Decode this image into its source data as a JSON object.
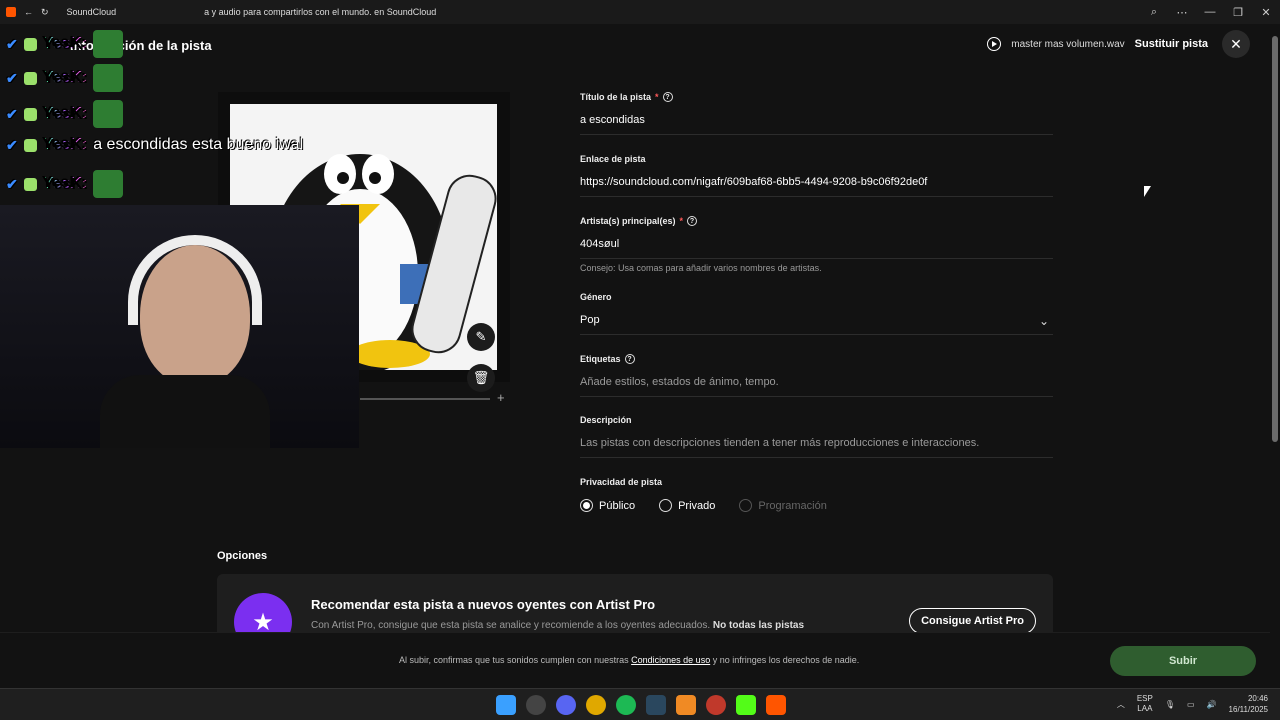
{
  "window": {
    "title": "SoundCloud",
    "title_suffix": "a y audio para compartirlos con el mundo. en SoundCloud"
  },
  "header": {
    "title": "Información de la pista",
    "file_name": "master mas volumen.wav",
    "replace_label": "Sustituir pista",
    "close_icon": "close-icon"
  },
  "form": {
    "title": {
      "label": "Título de la pista",
      "value": "a escondidas"
    },
    "link": {
      "label": "Enlace de pista",
      "value": "https://soundcloud.com/nigafr/609baf68-6bb5-4494-9208-b9c06f92de0f"
    },
    "artist": {
      "label": "Artista(s) principal(es)",
      "value": "404søul",
      "hint": "Consejo: Usa comas para añadir varios nombres de artistas."
    },
    "genre": {
      "label": "Género",
      "value": "Pop"
    },
    "tags": {
      "label": "Etiquetas",
      "placeholder": "Añade estilos, estados de ánimo, tempo."
    },
    "description": {
      "label": "Descripción",
      "placeholder": "Las pistas con descripciones tienden a tener más reproducciones e interacciones."
    },
    "privacy": {
      "label": "Privacidad de pista",
      "options": [
        "Público",
        "Privado",
        "Programación"
      ],
      "selected": "Público"
    },
    "required_mark": "*"
  },
  "options": {
    "title": "Opciones",
    "promo_title": "Recomendar esta pista a nuevos oyentes con Artist Pro",
    "promo_text": "Con Artist Pro, consigue que esta pista se analice y recomiende a los oyentes adecuados.",
    "promo_text_bold": "No todas las pistas",
    "promo_button": "Consigue Artist Pro"
  },
  "footer": {
    "text_before": "Al subir, confirmas que tus sonidos cumplen con nuestras",
    "link": "Condiciones de uso",
    "text_after": "y no infringes los derechos de nadie.",
    "upload_label": "Subir"
  },
  "chat": {
    "username": "YesK:",
    "message": "a escondidas esta bueno iwal"
  },
  "taskbar": {
    "lang_top": "ESP",
    "lang_bottom": "LAA",
    "time": "20:46",
    "date": "16/11/2025"
  },
  "colors": {
    "background": "#121212",
    "upload_button": "#2f5d2f",
    "accent_purple": "#7b2ff0"
  }
}
